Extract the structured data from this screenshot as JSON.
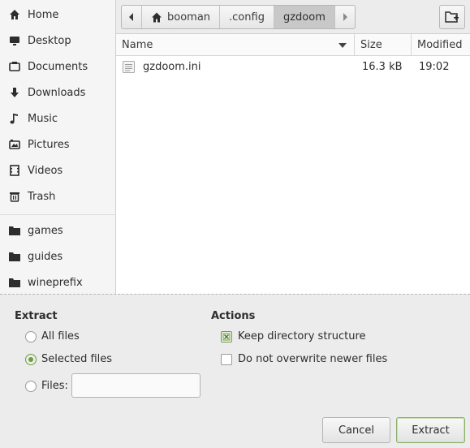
{
  "sidebar": {
    "places": [
      {
        "label": "Home",
        "icon": "home-icon"
      },
      {
        "label": "Desktop",
        "icon": "desktop-icon"
      },
      {
        "label": "Documents",
        "icon": "documents-icon"
      },
      {
        "label": "Downloads",
        "icon": "download-icon"
      },
      {
        "label": "Music",
        "icon": "music-icon"
      },
      {
        "label": "Pictures",
        "icon": "pictures-icon"
      },
      {
        "label": "Videos",
        "icon": "videos-icon"
      },
      {
        "label": "Trash",
        "icon": "trash-icon"
      }
    ],
    "bookmarks": [
      {
        "label": "games",
        "icon": "folder-icon"
      },
      {
        "label": "guides",
        "icon": "folder-icon"
      },
      {
        "label": "wineprefix",
        "icon": "folder-icon"
      }
    ]
  },
  "pathbar": {
    "segments": [
      "booman",
      ".config",
      "gzdoom"
    ],
    "active_index": 2
  },
  "filelist": {
    "columns": {
      "name": "Name",
      "size": "Size",
      "modified": "Modified"
    },
    "rows": [
      {
        "name": "gzdoom.ini",
        "size": "16.3 kB",
        "modified": "19:02"
      }
    ]
  },
  "extract": {
    "heading": "Extract",
    "all_files": "All files",
    "selected_files": "Selected files",
    "files_label": "Files:",
    "files_value": "",
    "selected_option": "selected_files"
  },
  "actions": {
    "heading": "Actions",
    "keep_structure": "Keep directory structure",
    "keep_structure_checked": true,
    "no_overwrite": "Do not overwrite newer files",
    "no_overwrite_checked": false
  },
  "buttons": {
    "cancel": "Cancel",
    "extract": "Extract"
  },
  "colors": {
    "accent": "#6f9c4a",
    "active_path": "#c8c8c8"
  }
}
